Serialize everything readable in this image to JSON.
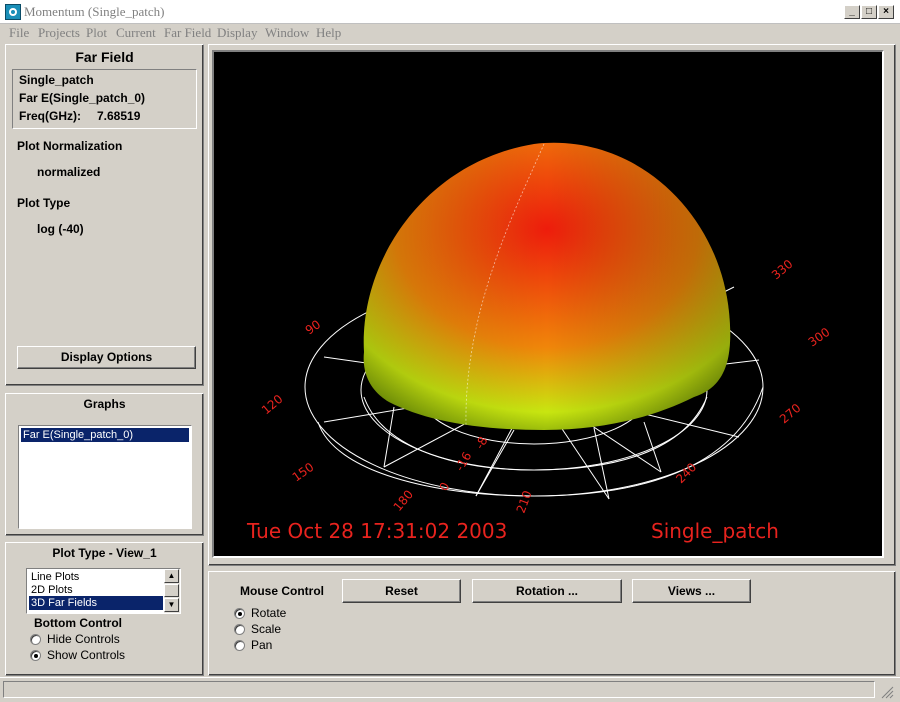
{
  "window": {
    "title": "Momentum (Single_patch)",
    "minimize_glyph": "_",
    "maximize_glyph": "□",
    "close_glyph": "×"
  },
  "menu": [
    "File",
    "Projects",
    "Plot",
    "Current",
    "Far Field",
    "Display",
    "Window",
    "Help"
  ],
  "far_field_panel": {
    "heading": "Far Field",
    "info": {
      "project": "Single_patch",
      "measurement": "Far E(Single_patch_0)",
      "freq_label": "Freq(GHz):",
      "freq_value": "7.68519"
    },
    "normalization_label": "Plot Normalization",
    "normalization_value": "normalized",
    "plot_type_label": "Plot Type",
    "plot_type_value": "log (-40)",
    "display_options_button": "Display Options"
  },
  "graphs_panel": {
    "heading": "Graphs",
    "items": [
      "Far E(Single_patch_0)"
    ],
    "selected_index": 0
  },
  "plot_type_panel": {
    "heading": "Plot Type - View_1",
    "options": [
      "Line Plots",
      "2D Plots",
      "3D Far Fields"
    ],
    "selected": "3D Far Fields",
    "bottom_control_label": "Bottom Control",
    "bottom_control_options": [
      "Hide Controls",
      "Show Controls"
    ],
    "bottom_control_selected": "Show Controls"
  },
  "plot": {
    "timestamp": "Tue Oct 28 17:31:02 2003",
    "design_name": "Single_patch",
    "angle_labels": [
      "90",
      "120",
      "150",
      "180",
      "210",
      "240",
      "270",
      "300",
      "330"
    ],
    "inner_labels": [
      "0",
      "-16",
      "-8"
    ],
    "label_color": "#e8231e",
    "grid_color": "#ffffff",
    "pattern_top_color": "#ee1c0c",
    "pattern_mid_color": "#f0860a",
    "pattern_bottom_color": "#c8e610"
  },
  "mouse_control": {
    "label": "Mouse Control",
    "options": [
      "Rotate",
      "Scale",
      "Pan"
    ],
    "selected": "Rotate",
    "reset_button": "Reset",
    "rotation_button": "Rotation ...",
    "views_button": "Views ..."
  }
}
